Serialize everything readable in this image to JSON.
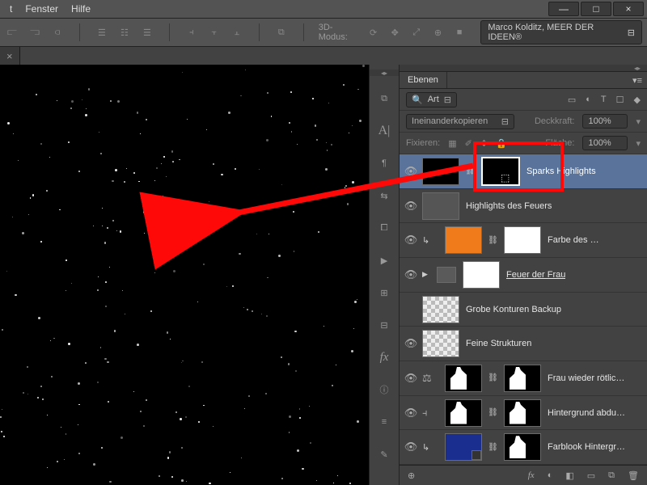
{
  "menubar": {
    "items": [
      "t",
      "Fenster",
      "Hilfe"
    ]
  },
  "window_controls": {
    "min": "—",
    "max": "□",
    "close": "×"
  },
  "options_bar": {
    "mode_label": "3D-Modus:",
    "credit": "Marco Kolditz, MEER DER IDEEN®"
  },
  "document_tab": {
    "close": "×"
  },
  "panel": {
    "title": "Ebenen",
    "filter_label": "Art",
    "type_icons": [
      "▭",
      "◐",
      "T",
      "☐",
      "◆"
    ],
    "blend_mode": "Ineinanderkopieren",
    "opacity_label": "Deckkraft:",
    "opacity_value": "100%",
    "lock_label": "Fixieren:",
    "fill_label": "Fläche:",
    "fill_value": "100%"
  },
  "layers": [
    {
      "name": "Sparks Highlights",
      "selected": true,
      "eye": true,
      "mask": true,
      "thumb": "sparks"
    },
    {
      "name": "Highlights des Feuers",
      "eye": true,
      "thumb": "gray"
    },
    {
      "name": "Farbe des …",
      "eye": true,
      "indent": true,
      "thumb": "orange",
      "mask": true,
      "mask_white": true
    },
    {
      "name": "Feuer der Frau ",
      "eye": true,
      "folder": true,
      "caret": true,
      "thumb": "white",
      "link": true
    },
    {
      "name": "Grobe Konturen Backup",
      "eye": false,
      "thumb": "checker"
    },
    {
      "name": "Feine Strukturen",
      "eye": true,
      "thumb": "checker"
    },
    {
      "name": "Frau wieder rötlic…",
      "eye": true,
      "indent": true,
      "scales": true,
      "mask": true,
      "thumb": "silh"
    },
    {
      "name": "Hintergrund abdu…",
      "eye": true,
      "indent": true,
      "levels": true,
      "mask": true,
      "thumb": "silh"
    },
    {
      "name": "Farblook Hintergr…",
      "eye": true,
      "indent": true,
      "thumb": "blue",
      "mask": true,
      "thumb2": "silh",
      "smart": true
    }
  ],
  "footer_icons": [
    "⊕",
    "fx",
    "◐",
    "◧",
    "▭",
    "⧉",
    "🗑"
  ]
}
